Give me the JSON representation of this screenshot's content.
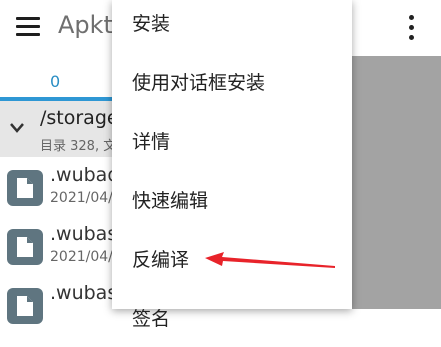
{
  "appbar": {
    "title": "Apkto"
  },
  "tabs": {
    "first_label": "0"
  },
  "path": {
    "current": "/storage",
    "summary": "目录 328, 文"
  },
  "files": [
    {
      "name": ".wubad",
      "date": "2021/04/"
    },
    {
      "name": ".wubas",
      "date": "2021/04/"
    },
    {
      "name": ".wubas",
      "date": ""
    }
  ],
  "context_menu": {
    "items": [
      "安装",
      "使用对话框安装",
      "详情",
      "快速编辑",
      "反编译",
      "签名"
    ]
  },
  "colors": {
    "accent": "#2e97d4",
    "arrow": "#e8232a",
    "file_icon": "#5f7580"
  }
}
